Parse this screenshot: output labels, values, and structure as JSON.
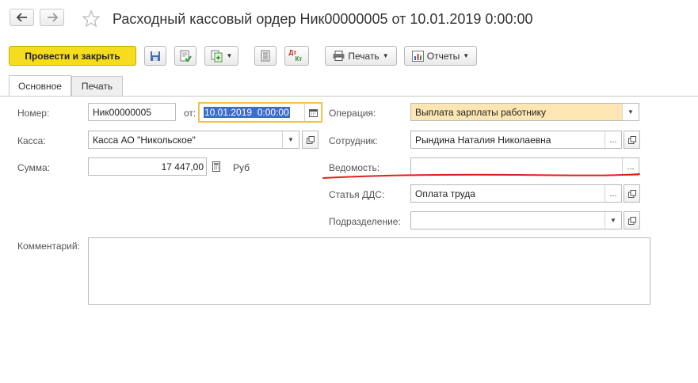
{
  "header": {
    "title": "Расходный кассовый ордер Ник00000005 от 10.01.2019 0:00:00",
    "icons": [
      "arrow-left-icon",
      "arrow-right-icon",
      "star-icon"
    ]
  },
  "toolbar": {
    "post_close_label": "Провести и закрыть",
    "print_label": "Печать",
    "reports_label": "Отчеты",
    "dt_kt_label": {
      "dt": "Дт",
      "kt": "Кт"
    }
  },
  "tabs": [
    {
      "label": "Основное",
      "active": true
    },
    {
      "label": "Печать",
      "active": false
    }
  ],
  "form": {
    "number": {
      "label": "Номер:",
      "value": "Ник00000005"
    },
    "date": {
      "label": "от:",
      "value": "10.01.2019  0:00:00"
    },
    "kassa": {
      "label": "Касса:",
      "value": "Касса АО \"Никольское\""
    },
    "amount": {
      "label": "Сумма:",
      "value": "17 447,00",
      "currency": "Руб"
    },
    "operation": {
      "label": "Операция:",
      "value": "Выплата зарплаты работнику"
    },
    "employee": {
      "label": "Сотрудник:",
      "value": "Рындина Наталия Николаевна"
    },
    "statement": {
      "label": "Ведомость:",
      "value": ""
    },
    "dds": {
      "label": "Статья ДДС:",
      "value": "Оплата труда"
    },
    "department": {
      "label": "Подразделение:",
      "value": ""
    },
    "comment": {
      "label": "Комментарий:",
      "value": ""
    }
  },
  "colors": {
    "primary_button": "#f5dc1e",
    "operation_field": "#fde6b3",
    "date_selection": "#3b6fc4",
    "annotation_line": "#e02020"
  }
}
